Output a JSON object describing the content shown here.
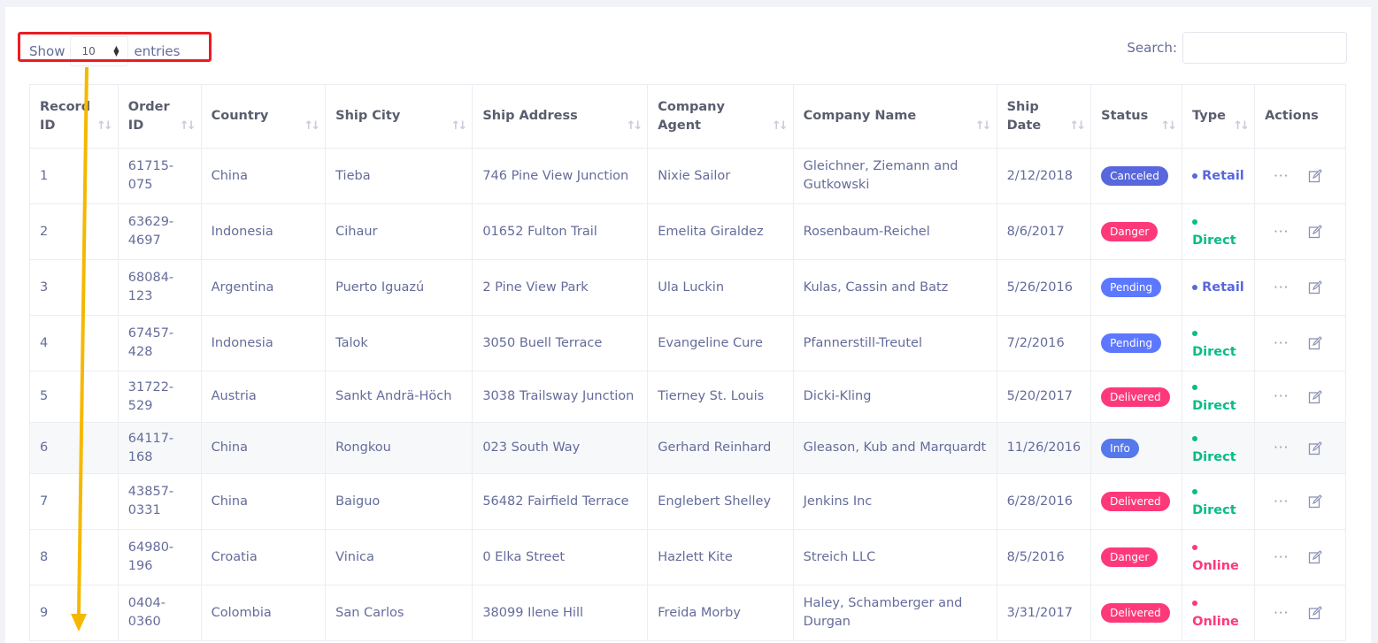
{
  "controls": {
    "show_label": "Show",
    "entries_value": "10",
    "entries_label": "entries",
    "search_label": "Search:",
    "search_value": ""
  },
  "columns": [
    {
      "label": "Record ID",
      "line1": "Record",
      "line2": "ID"
    },
    {
      "label": "Order ID",
      "line1": "Order",
      "line2": "ID"
    },
    {
      "label": "Country",
      "line1": "Country",
      "line2": ""
    },
    {
      "label": "Ship City",
      "line1": "Ship City",
      "line2": ""
    },
    {
      "label": "Ship Address",
      "line1": "Ship Address",
      "line2": ""
    },
    {
      "label": "Company Agent",
      "line1": "Company",
      "line2": "Agent"
    },
    {
      "label": "Company Name",
      "line1": "Company Name",
      "line2": ""
    },
    {
      "label": "Ship Date",
      "line1": "Ship",
      "line2": "Date"
    },
    {
      "label": "Status",
      "line1": "Status",
      "line2": ""
    },
    {
      "label": "Type",
      "line1": "Type",
      "line2": ""
    },
    {
      "label": "Actions",
      "line1": "Actions",
      "line2": ""
    }
  ],
  "rows": [
    {
      "record_id": "1",
      "order_id": "61715-075",
      "country": "China",
      "ship_city": "Tieba",
      "ship_address": "746 Pine View Junction",
      "agent": "Nixie Sailor",
      "company": "Gleichner, Ziemann and Gutkowski",
      "ship_date": "2/12/2018",
      "status": "Canceled",
      "status_color": "#5867dd",
      "type": "Retail",
      "type_color": "#5867dd"
    },
    {
      "record_id": "2",
      "order_id": "63629-4697",
      "country": "Indonesia",
      "ship_city": "Cihaur",
      "ship_address": "01652 Fulton Trail",
      "agent": "Emelita Giraldez",
      "company": "Rosenbaum-Reichel",
      "ship_date": "8/6/2017",
      "status": "Danger",
      "status_color": "#fd397a",
      "type": "Direct",
      "type_color": "#0abb87"
    },
    {
      "record_id": "3",
      "order_id": "68084-123",
      "country": "Argentina",
      "ship_city": "Puerto Iguazú",
      "ship_address": "2 Pine View Park",
      "agent": "Ula Luckin",
      "company": "Kulas, Cassin and Batz",
      "ship_date": "5/26/2016",
      "status": "Pending",
      "status_color": "#5d78ff",
      "type": "Retail",
      "type_color": "#5867dd"
    },
    {
      "record_id": "4",
      "order_id": "67457-428",
      "country": "Indonesia",
      "ship_city": "Talok",
      "ship_address": "3050 Buell Terrace",
      "agent": "Evangeline Cure",
      "company": "Pfannerstill-Treutel",
      "ship_date": "7/2/2016",
      "status": "Pending",
      "status_color": "#5d78ff",
      "type": "Direct",
      "type_color": "#0abb87"
    },
    {
      "record_id": "5",
      "order_id": "31722-529",
      "country": "Austria",
      "ship_city": "Sankt Andrä-Höch",
      "ship_address": "3038 Trailsway Junction",
      "agent": "Tierney St. Louis",
      "company": "Dicki-Kling",
      "ship_date": "5/20/2017",
      "status": "Delivered",
      "status_color": "#fd397a",
      "type": "Direct",
      "type_color": "#0abb87"
    },
    {
      "record_id": "6",
      "order_id": "64117-168",
      "country": "China",
      "ship_city": "Rongkou",
      "ship_address": "023 South Way",
      "agent": "Gerhard Reinhard",
      "company": "Gleason, Kub and Marquardt",
      "ship_date": "11/26/2016",
      "status": "Info",
      "status_color": "#5578eb",
      "type": "Direct",
      "type_color": "#0abb87"
    },
    {
      "record_id": "7",
      "order_id": "43857-0331",
      "country": "China",
      "ship_city": "Baiguo",
      "ship_address": "56482 Fairfield Terrace",
      "agent": "Englebert Shelley",
      "company": "Jenkins Inc",
      "ship_date": "6/28/2016",
      "status": "Delivered",
      "status_color": "#fd397a",
      "type": "Direct",
      "type_color": "#0abb87"
    },
    {
      "record_id": "8",
      "order_id": "64980-196",
      "country": "Croatia",
      "ship_city": "Vinica",
      "ship_address": "0 Elka Street",
      "agent": "Hazlett Kite",
      "company": "Streich LLC",
      "ship_date": "8/5/2016",
      "status": "Danger",
      "status_color": "#fd397a",
      "type": "Online",
      "type_color": "#fd397a"
    },
    {
      "record_id": "9",
      "order_id": "0404-0360",
      "country": "Colombia",
      "ship_city": "San Carlos",
      "ship_address": "38099 Ilene Hill",
      "agent": "Freida Morby",
      "company": "Haley, Schamberger and Durgan",
      "ship_date": "3/31/2017",
      "status": "Delivered",
      "status_color": "#fd397a",
      "type": "Online",
      "type_color": "#fd397a"
    }
  ],
  "icons": {
    "more": "more-horizontal-icon",
    "edit": "edit-icon",
    "sort": "sort-icon"
  },
  "colors": {
    "highlight_box": "#ec1c24",
    "arrow": "#f5b800"
  }
}
